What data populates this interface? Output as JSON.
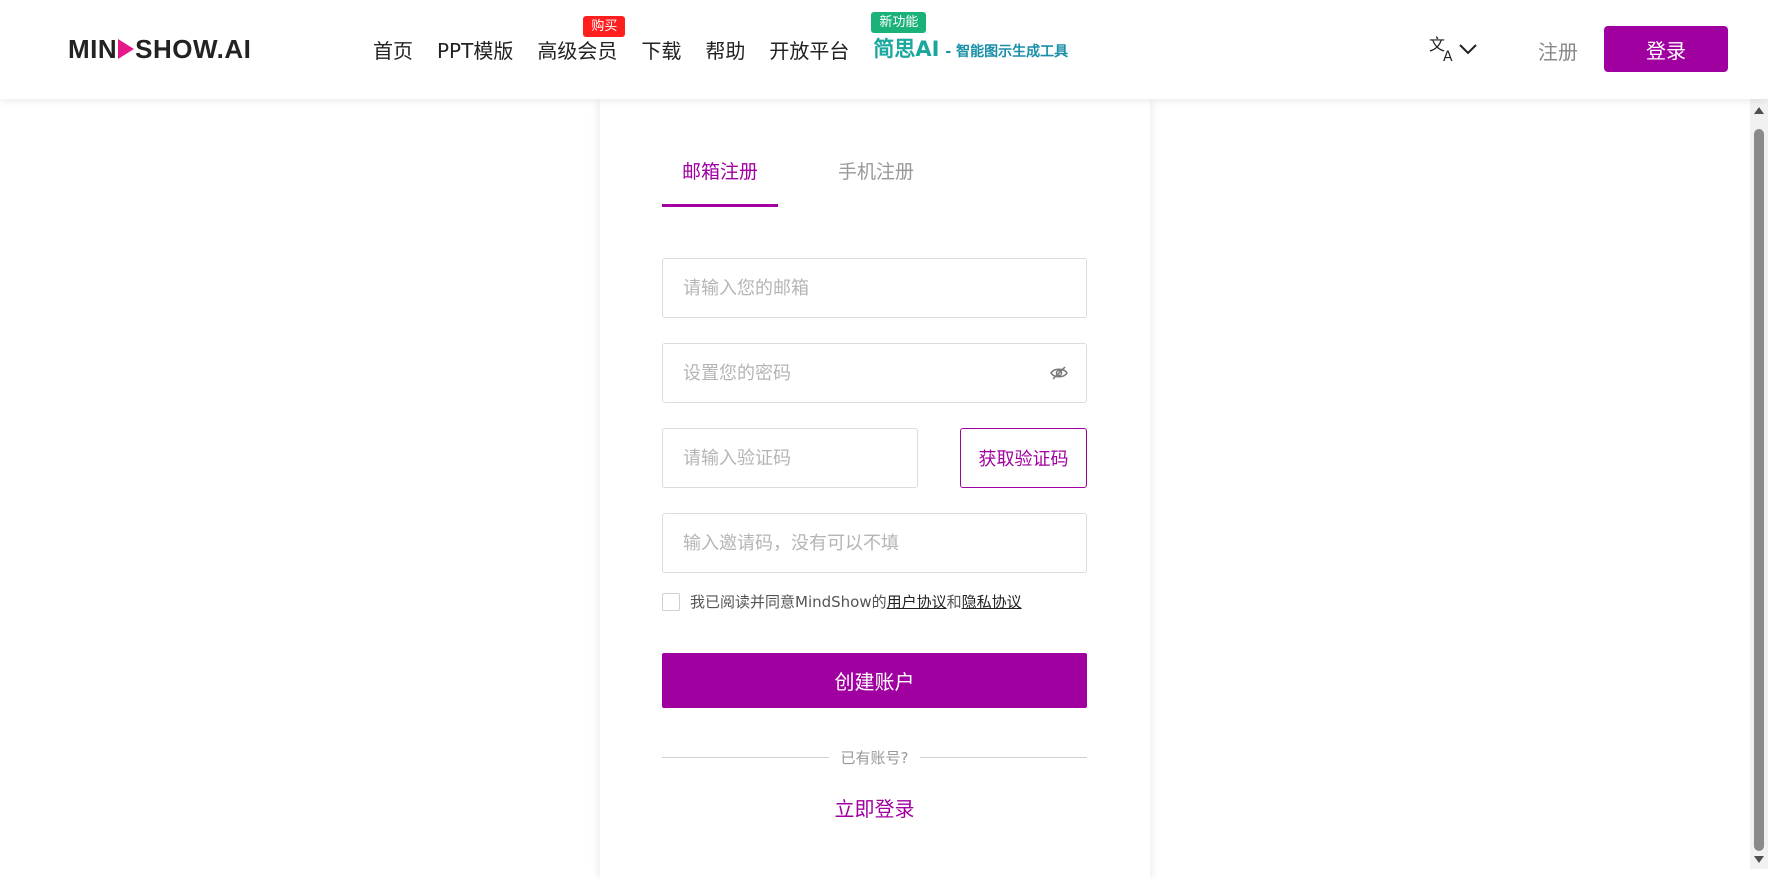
{
  "header": {
    "logo": {
      "text_before": "MIN",
      "text_after": "SHOW.AI",
      "icon": "play-icon",
      "icon_color": "#e5198a"
    },
    "nav": [
      {
        "label": "首页"
      },
      {
        "label": "PPT模版"
      },
      {
        "label": "高级会员",
        "badge": "购买",
        "badge_color": "#ff1f1f"
      },
      {
        "label": "下载"
      },
      {
        "label": "帮助"
      },
      {
        "label": "开放平台"
      }
    ],
    "ai_feature": {
      "badge": "新功能",
      "badge_color": "#1bb27a",
      "main": "简思AI",
      "sub": "- 智能图示生成工具"
    },
    "language_icon": "translate-icon",
    "register_label": "注册",
    "login_label": "登录",
    "accent": "#a100a1"
  },
  "form": {
    "tabs": [
      {
        "label": "邮箱注册",
        "active": true
      },
      {
        "label": "手机注册",
        "active": false
      }
    ],
    "email_placeholder": "请输入您的邮箱",
    "password_placeholder": "设置您的密码",
    "password_toggle_icon": "eye-slash-icon",
    "code_placeholder": "请输入验证码",
    "get_code_label": "获取验证码",
    "invite_placeholder": "输入邀请码，没有可以不填",
    "agreement": {
      "prefix": "我已阅读并同意MindShow的",
      "user_agreement": "用户协议",
      "and": "和",
      "privacy": "隐私协议"
    },
    "create_label": "创建账户",
    "have_account": "已有账号?",
    "login_now": "立即登录"
  }
}
